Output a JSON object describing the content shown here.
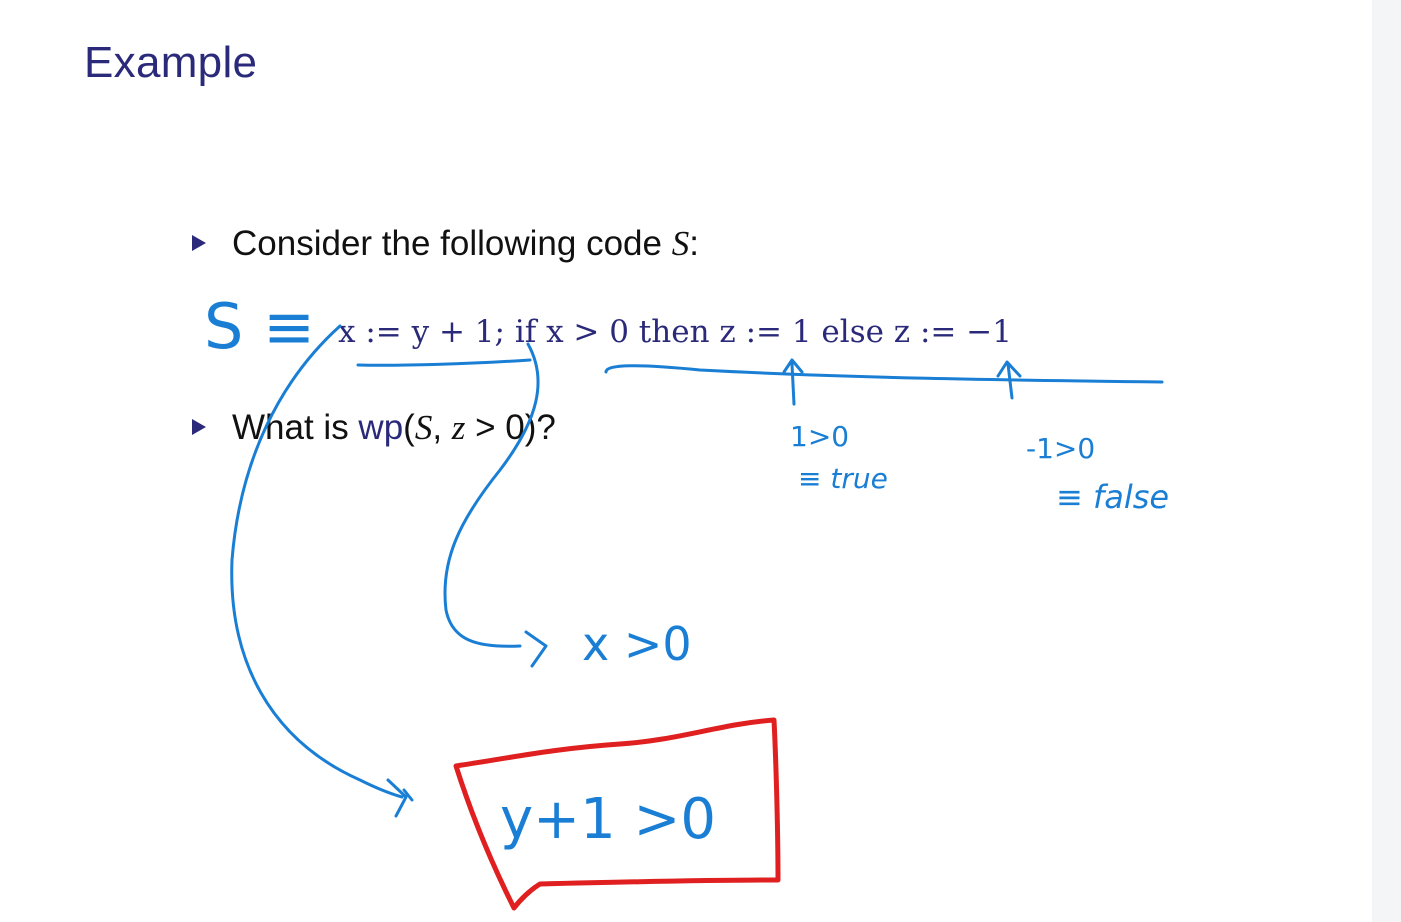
{
  "title": "Example",
  "bullets": {
    "first_text": "Consider the following code ",
    "first_var": "S",
    "first_tail": ":",
    "second_pre": "What is ",
    "second_wp": "wp",
    "second_open": "(",
    "second_s": "S",
    "second_comma": ", ",
    "second_z": "z",
    "second_rest": " > 0)?"
  },
  "code": "x := y + 1; if x > 0 then z := 1 else z := −1",
  "annotations": {
    "s_def": "S ≡",
    "then_cond": "1>0",
    "then_result": "≡ true",
    "else_cond": "-1>0",
    "else_result": "≡ false",
    "mid_result": "x >0",
    "final_result": "y+1 >0"
  },
  "colors": {
    "title": "#2b2a7a",
    "ink_blue": "#1a7fd4",
    "ink_red": "#e02020"
  }
}
